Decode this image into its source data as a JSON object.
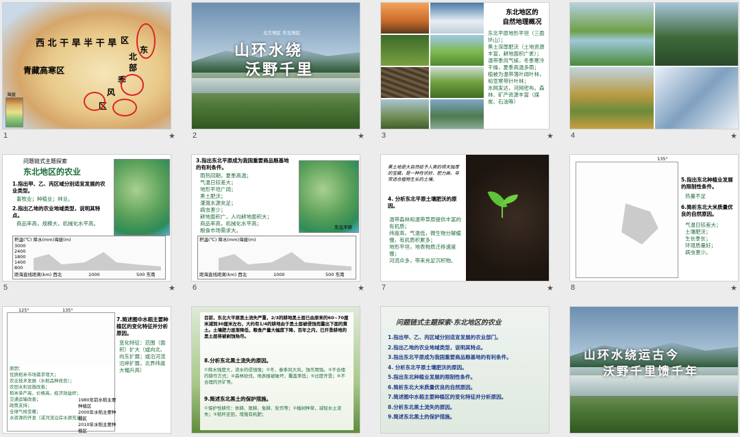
{
  "slides": [
    {
      "num": "1",
      "map_labels": [
        "西",
        "北",
        "干",
        "旱",
        "半",
        "干",
        "旱",
        "区",
        "东",
        "北",
        "部",
        "青",
        "藏",
        "高",
        "寒",
        "区",
        "季",
        "风",
        "区"
      ],
      "legend_title": "海拔"
    },
    {
      "num": "2",
      "subtitle": "北方地区 东北地区",
      "title_line1": "山环水绕",
      "title_line2": "沃野千里"
    },
    {
      "num": "3",
      "title": "东北地区的",
      "title2": "自然地理概况",
      "bullets": [
        "东北平原地形平坦（三面环山）；",
        "黑土深厚肥沃（土地资源丰富，耕地面积广袤）；",
        "温带季风气候，冬季寒冷干燥，夏季高温多雨；",
        "植被为温带落叶阔叶林，和亚寒带针叶林；",
        "水网发达，河网密布。森林、矿产资源丰富（煤炭、石油等）"
      ]
    },
    {
      "num": "4"
    },
    {
      "num": "5",
      "header": "问题链式主题探索",
      "title": "东北地区的农业",
      "q1": "1.指出甲、乙、丙区域分别适宜发展的农业类型。",
      "a1": "畜牧业；种植业；林业。",
      "q2": "2.指出乙地的农业地域类型，说明其特点。",
      "a2": "商品率高，规模大，机械化水平高。",
      "chart_ylabel": "积温(℃) 降水(mm)海拔(m)",
      "chart_yticks": [
        "3000",
        "2400",
        "1800",
        "1400",
        "800",
        "200"
      ],
      "chart_xlabel": "距海直线距离(km) 西北",
      "chart_x1": "1000",
      "chart_x2": "500 东南"
    },
    {
      "num": "6",
      "q3": "3.指出东北平原成为我国重要商品粮基地的有利条件。",
      "bullets": [
        "雨热同期，夏季高温；",
        "气温日较差大；",
        "地形平坦广阔；",
        "黑土肥沃；",
        "灌溉水源充足；",
        "病虫害少；",
        "耕地面积广，人均耕地面积大；",
        "商品率高，机械化水平高；",
        "粮食市场需求大。"
      ],
      "map_caption": "东北平原",
      "chart_ylabel": "积温(℃) 降水(mm)海拔(m)",
      "chart_xlabel": "距海直线距离(km) 西北",
      "chart_x1": "1000",
      "chart_x2": "500 东南"
    },
    {
      "num": "7",
      "intro": "黑土地是大自然给予人类的得天独厚的宝藏，是一种性状好、肥力高、非常适合植物生长的土壤。",
      "q4": "4. 分析东北平原土壤肥沃的原因。",
      "bullets": [
        "温带森林和温带草原提供丰富的有机质；",
        "纬度高，气温低，微生物分解缓慢，有机质积累多；",
        "地形平坦，地表物质迁移速度慢；",
        "河流众多，带来充足沉积物。"
      ]
    },
    {
      "num": "8",
      "lon": "135°",
      "q5": "5.指出东北种植业发展的限制性条件。",
      "a5": "热量不足",
      "q6": "6.简析东北大米质量优良的自然原因。",
      "bullets": [
        "气温日较差大；",
        "土壤肥沃；",
        "生长季长；",
        "环境质量好；",
        "病虫害少。"
      ]
    },
    {
      "num": "9",
      "lon1": "135°",
      "lon2": "125°",
      "q7": "7.简述图中水稻主要种植区的变化特征并分析原因。",
      "features": "变化特征：范围（面积）扩大（或向北、向东扩展；或沿河流沿岸扩展，北界纬度大幅升高）",
      "reasons": [
        "原因：",
        "优质稻米市场需求增大；",
        "农业技术发展（水稻品种改良）；",
        "农田水利设施改善；",
        "稻米单产高，价格高，经济效益好；",
        "交通运输改善；",
        "政策支持；",
        "全球气候变暖；",
        "水资源的开发（或河流沿岸水源充足）。"
      ],
      "legend": [
        "1980年前水稻主要种植区",
        "2000年水稻主要种植区",
        "2010年水稻主要种植区"
      ]
    },
    {
      "num": "10",
      "intro": "目前，东北大平原黑土流失严重，2/3的耕地黑土层已由原来的60~70厘米减到30厘米左右，大约有1/4的耕地由于黑土层被侵蚀而露出下面的黄土。土壤肥力逐渐降低，粮食产量大幅度下降，百年之内，已开垦耕地的黑土层将被剥蚀殆尽。",
      "q8": "8.分析东北黑土流失的原因。",
      "a8": "①降水强度大，流水的侵蚀强；②冬、春季风大风，蚀作用强。③不合理的耕作方式；④森林砍伐，地表植被破坏，覆盖率低；⑤过度开垦；⑥不合理的开矿等。",
      "q9": "9.简述东北黑土的保护措施。",
      "a9": "①保护性耕作：休耕、限耕、免耕、轮作等；②植树种草，减轻水土流失；③秸秆还田，增施有机肥；"
    },
    {
      "num": "11",
      "title": "问题链式主题探索·东北地区的农业",
      "items": [
        "1.指出甲、乙、丙区域分别适宜发展的农业部门。",
        "2.指出乙地的农业地域类型，说明其特点。",
        "3.指出东北平原成为我国重要商品粮基地的有利条件。",
        "4. 分析东北平原土壤肥沃的原因。",
        "5.指出东北种植业发展的限制性条件。",
        "6.简析东北大米质量优良的自然原因。",
        "7.简述图中水稻主要种植区的变化特征并分析原因。",
        "8.分析东北黑土流失的原因。",
        "9.简述东北黑土的保护措施。"
      ]
    },
    {
      "num": "12",
      "title_line1": "山环水绕运古今",
      "title_line2": "沃野千里馈千年"
    }
  ],
  "star": "★",
  "colors": {
    "accent": "#1c6b3a",
    "title_green": "#2e7d32",
    "item_blue": "#1e3c8a"
  }
}
